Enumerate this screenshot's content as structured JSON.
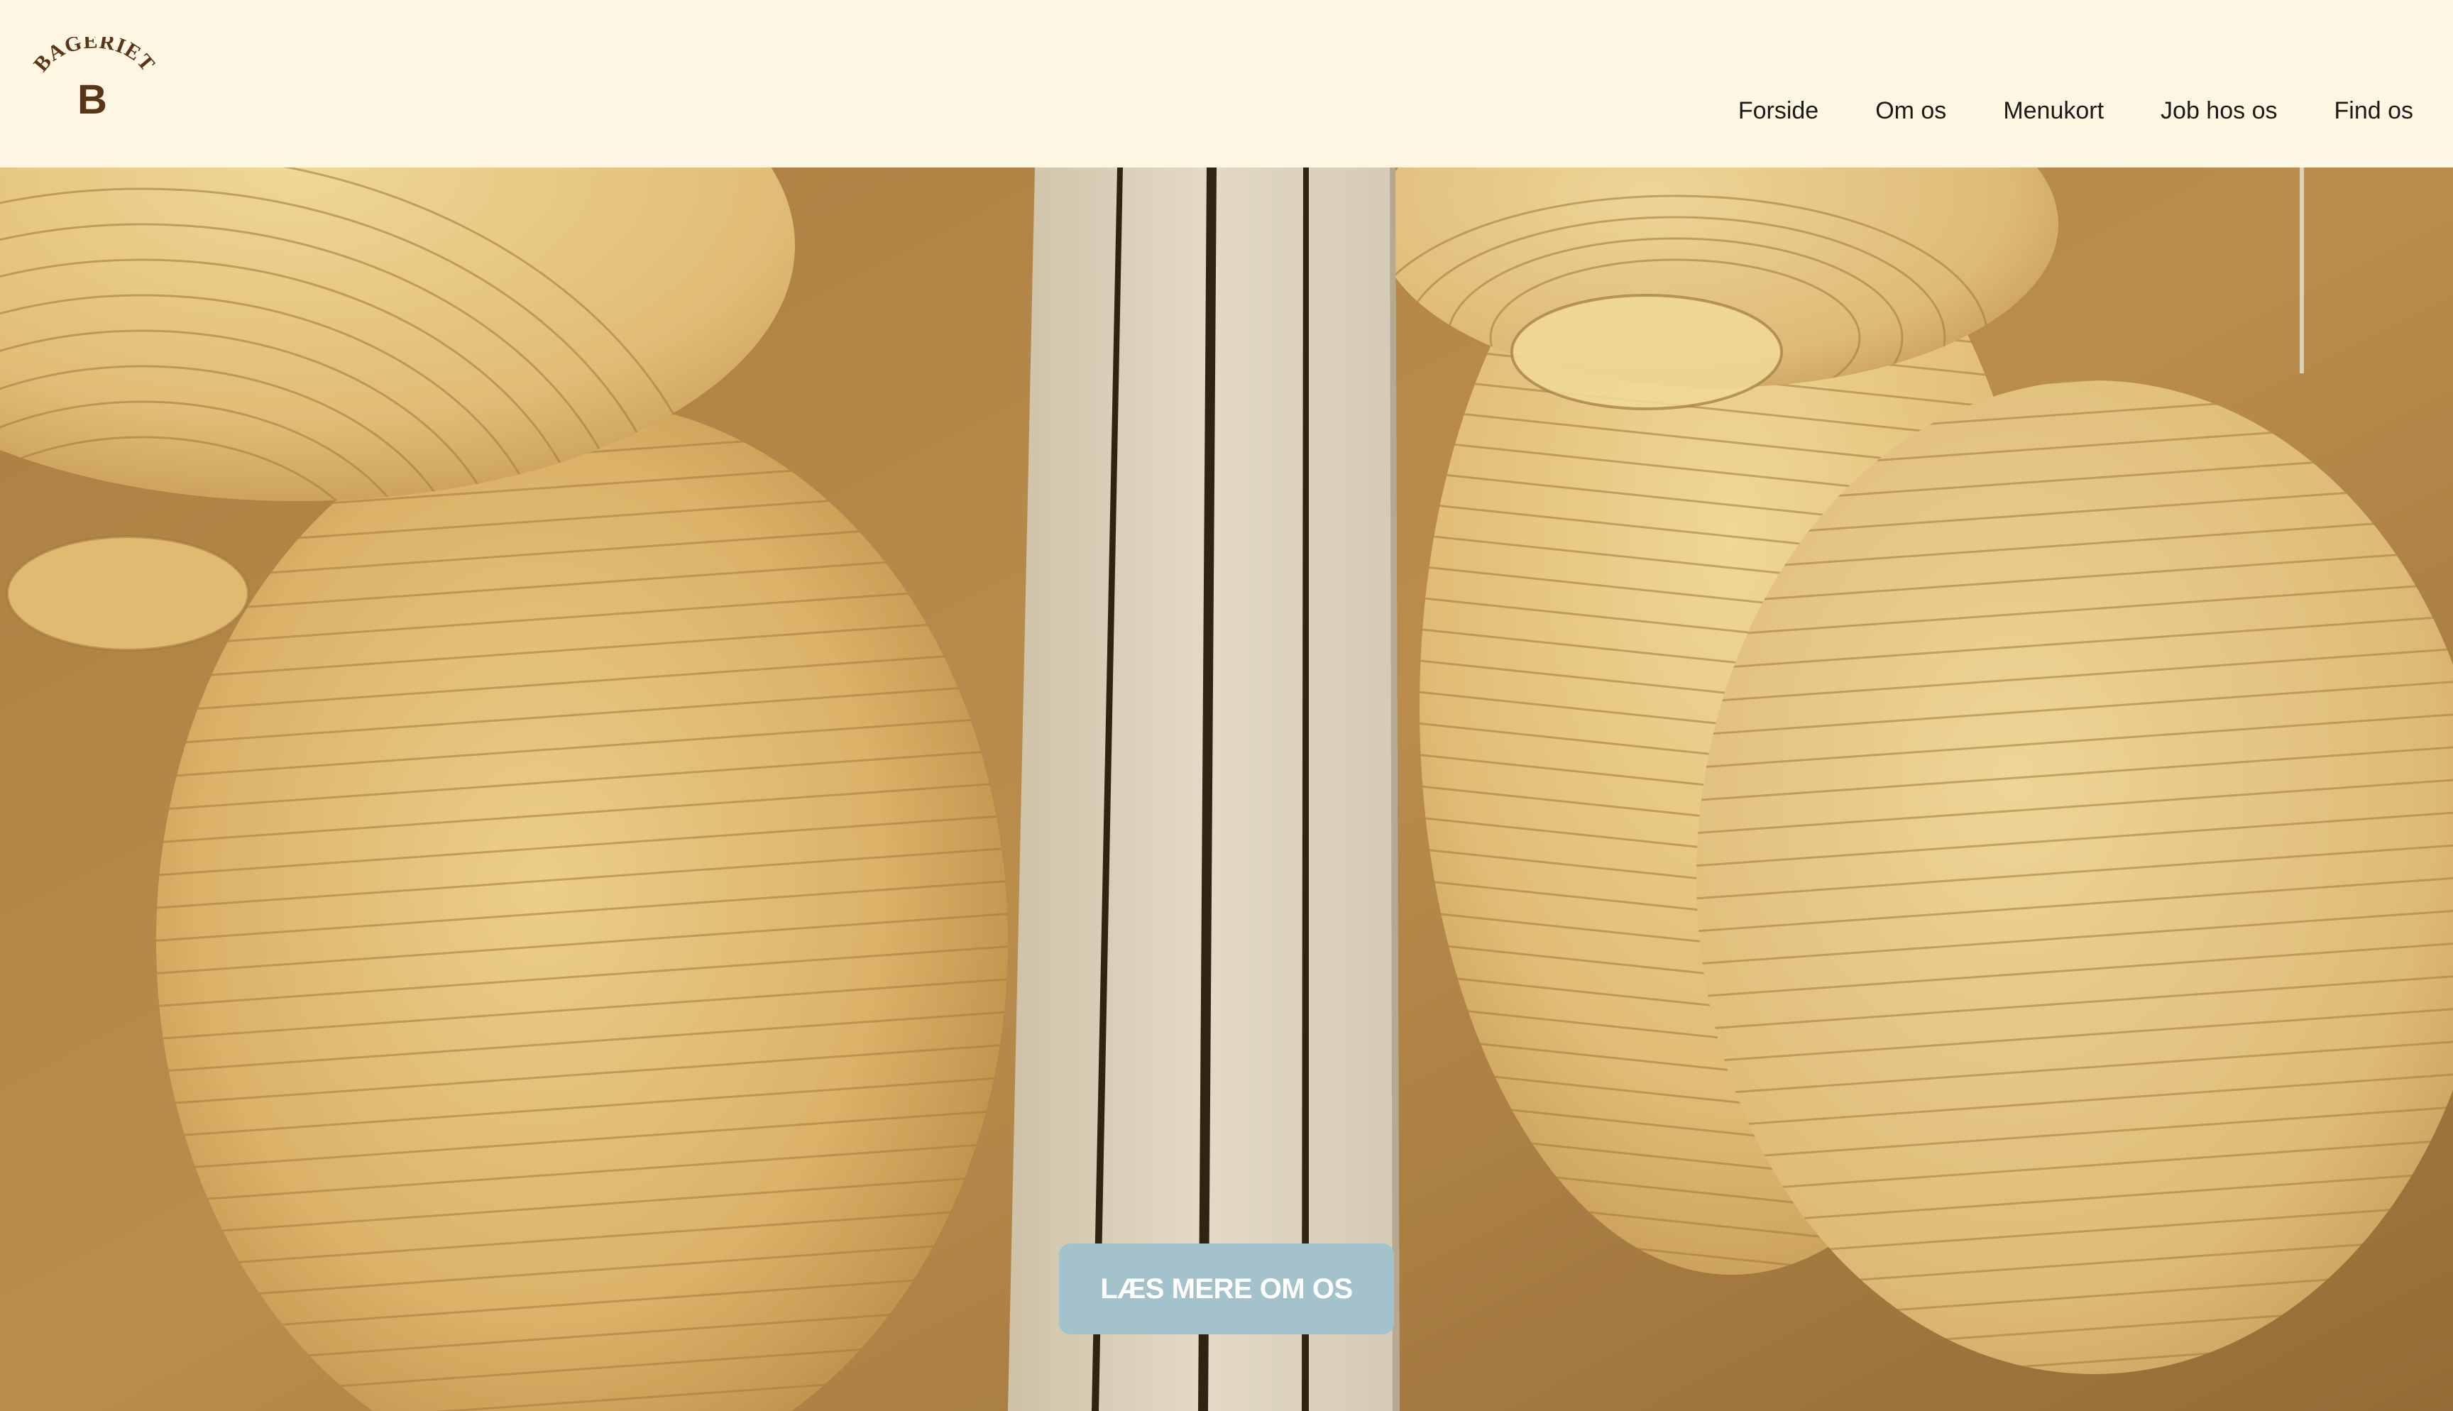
{
  "brand": {
    "name": "BAGERIET",
    "monogram": "B",
    "logo_color": "#5a3515",
    "logo_icon": "bageriet-b-logo"
  },
  "nav": {
    "items": [
      {
        "label": "Forside"
      },
      {
        "label": "Om os"
      },
      {
        "label": "Menukort"
      },
      {
        "label": "Job hos os"
      },
      {
        "label": "Find os"
      }
    ]
  },
  "hero": {
    "image_subject": "paper-lanterns",
    "cta_label": "LÆS MERE OM OS",
    "cta_color": "#a3c2cb"
  },
  "colors": {
    "header_bg": "#fdf6e2",
    "text": "#1c1a17"
  }
}
